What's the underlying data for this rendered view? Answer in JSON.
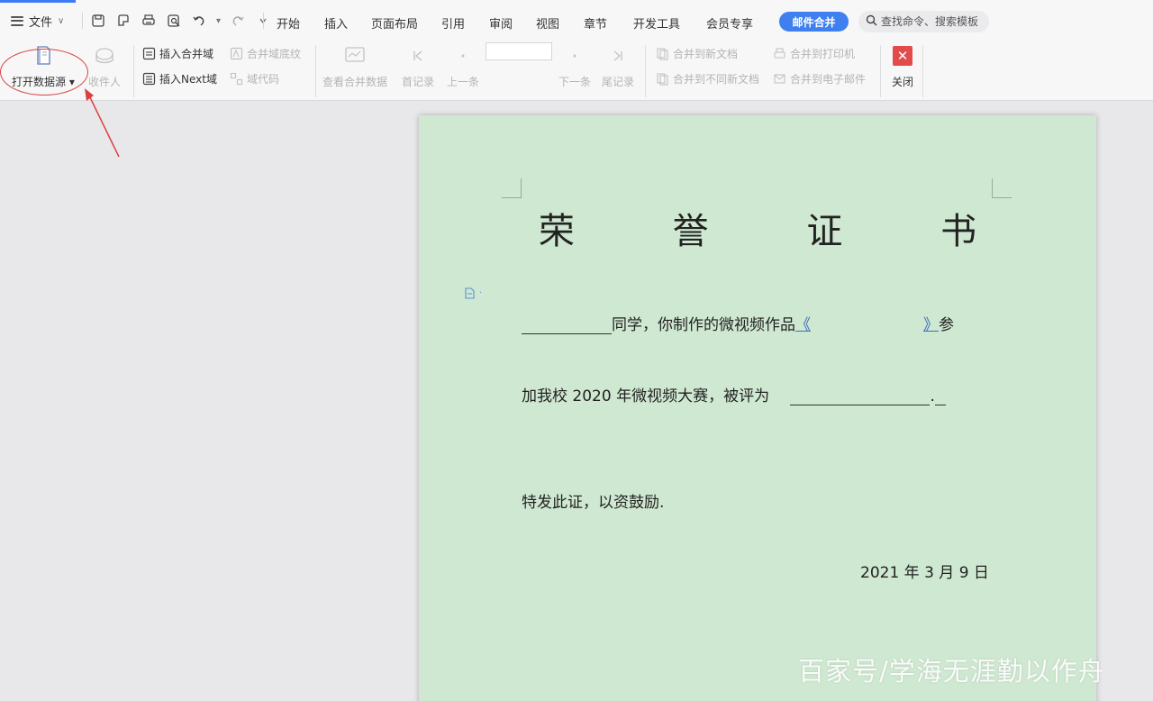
{
  "menubar": {
    "file_label": "文件",
    "tabs": [
      "开始",
      "插入",
      "页面布局",
      "引用",
      "审阅",
      "视图",
      "章节",
      "开发工具",
      "会员专享"
    ],
    "member_button": "邮件合并",
    "search_placeholder": "查找命令、搜索模板",
    "accent_color": "#3b7bf6"
  },
  "ribbon": {
    "open_source": "打开数据源",
    "recipients": "收件人",
    "insert_merge_field": "插入合并域",
    "merge_field_shading": "合并域底纹",
    "insert_next": "插入Next域",
    "view_merged_data": "查看合并数据",
    "first_record": "首记录",
    "previous_record": "上一条",
    "next_record": "下一条",
    "last_record": "尾记录",
    "merge_to_new_doc": "合并到新文档",
    "merge_to_different_docs": "合并到不同新文档",
    "merge_to_printer": "合并到打印机",
    "merge_to_email": "合并到电子邮件",
    "close": "关闭"
  },
  "document": {
    "title": "荣 誉 证 书",
    "line1_text": "同学，你制作的微视频作品",
    "line1_open": "《",
    "line1_close": "》",
    "line1_end": "参",
    "line2_text": "加我校 2020 年微视频大赛，被评为",
    "line2_end": ".",
    "line3_text": "特发此证，以资鼓励.",
    "date": "2021 年 3 月 9 日",
    "page_color": "#cfe8d1"
  },
  "watermark": "百家号/学海无涯勤以作舟"
}
